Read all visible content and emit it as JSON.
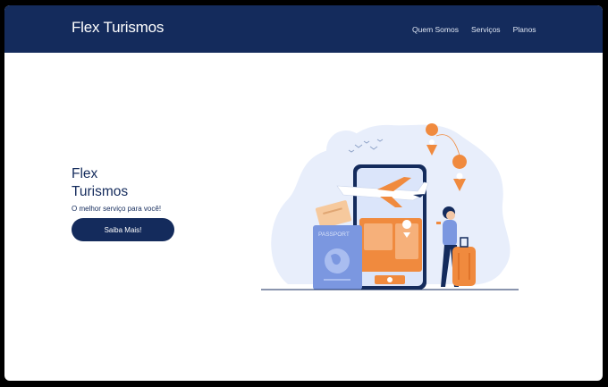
{
  "navbar": {
    "brand": "Flex Turismos",
    "links": [
      {
        "label": "Quem Somos"
      },
      {
        "label": "Serviços"
      },
      {
        "label": "Planos"
      }
    ]
  },
  "hero": {
    "title_line1": "Flex",
    "title_line2": "Turismos",
    "subtitle": "O melhor serviço para você!",
    "cta_label": "Saiba Mais!"
  },
  "illustration": {
    "passport_text": "PASSPORT"
  },
  "colors": {
    "primary": "#142b5c",
    "accent": "#f08a3e",
    "soft_blue": "#e8eefb"
  }
}
